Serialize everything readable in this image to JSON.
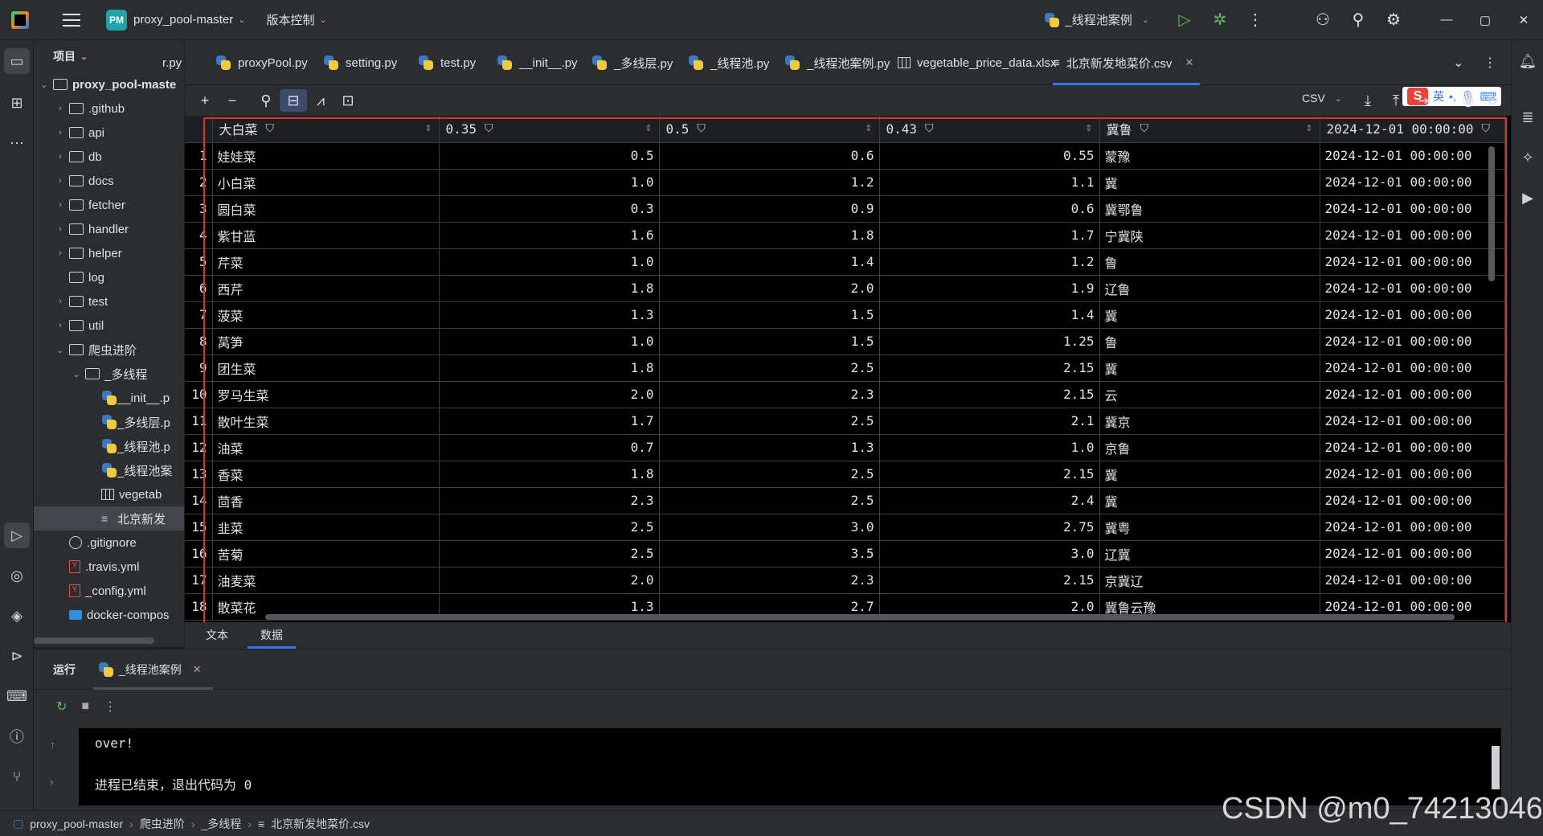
{
  "titlebar": {
    "project_badge": "PM",
    "project_name": "proxy_pool-master",
    "vcs": "版本控制",
    "run_config": "_线程池案例"
  },
  "project_panel": {
    "title": "项目",
    "root": "proxy_pool-maste",
    "items": [
      {
        "label": ".github",
        "type": "folder",
        "indent": 1,
        "arrow": "›"
      },
      {
        "label": "api",
        "type": "folder",
        "indent": 1,
        "arrow": "›"
      },
      {
        "label": "db",
        "type": "folder",
        "indent": 1,
        "arrow": "›"
      },
      {
        "label": "docs",
        "type": "folder",
        "indent": 1,
        "arrow": "›"
      },
      {
        "label": "fetcher",
        "type": "folder",
        "indent": 1,
        "arrow": "›"
      },
      {
        "label": "handler",
        "type": "folder",
        "indent": 1,
        "arrow": "›"
      },
      {
        "label": "helper",
        "type": "folder",
        "indent": 1,
        "arrow": "›"
      },
      {
        "label": "log",
        "type": "folder",
        "indent": 1,
        "arrow": ""
      },
      {
        "label": "test",
        "type": "folder",
        "indent": 1,
        "arrow": "›"
      },
      {
        "label": "util",
        "type": "folder",
        "indent": 1,
        "arrow": "›"
      },
      {
        "label": "爬虫进阶",
        "type": "folder",
        "indent": 1,
        "arrow": "⌄"
      },
      {
        "label": "_多线程",
        "type": "folder",
        "indent": 2,
        "arrow": "⌄"
      },
      {
        "label": "__init__.p",
        "type": "python",
        "indent": 3,
        "arrow": ""
      },
      {
        "label": "_多线层.p",
        "type": "python",
        "indent": 3,
        "arrow": ""
      },
      {
        "label": "_线程池.p",
        "type": "python",
        "indent": 3,
        "arrow": ""
      },
      {
        "label": "_线程池案",
        "type": "python",
        "indent": 3,
        "arrow": ""
      },
      {
        "label": "vegetab",
        "type": "table",
        "indent": 3,
        "arrow": ""
      },
      {
        "label": "北京新发",
        "type": "text",
        "indent": 3,
        "arrow": "",
        "selected": true
      },
      {
        "label": ".gitignore",
        "type": "git",
        "indent": 1,
        "arrow": ""
      },
      {
        "label": ".travis.yml",
        "type": "yaml",
        "indent": 1,
        "arrow": ""
      },
      {
        "label": "_config.yml",
        "type": "yaml",
        "indent": 1,
        "arrow": ""
      },
      {
        "label": "docker-compos",
        "type": "docker",
        "indent": 1,
        "arrow": ""
      }
    ]
  },
  "editor_tabs": [
    {
      "label": "r.py",
      "icon": "none"
    },
    {
      "label": "proxyPool.py",
      "icon": "python"
    },
    {
      "label": "setting.py",
      "icon": "python"
    },
    {
      "label": "test.py",
      "icon": "python"
    },
    {
      "label": "__init__.py",
      "icon": "python"
    },
    {
      "label": "_多线层.py",
      "icon": "python"
    },
    {
      "label": "_线程池.py",
      "icon": "python"
    },
    {
      "label": "_线程池案例.py",
      "icon": "python"
    },
    {
      "label": "vegetable_price_data.xlsx",
      "icon": "table"
    },
    {
      "label": "北京新发地菜价.csv",
      "icon": "text",
      "active": true
    }
  ],
  "data_toolbar": {
    "format": "CSV",
    "ime_label": "英"
  },
  "grid": {
    "headers": [
      "大白菜",
      "0.35",
      "0.5",
      "0.43",
      "冀鲁",
      "2024-12-01 00:00:00"
    ],
    "rows": [
      [
        "1",
        "娃娃菜",
        "0.5",
        "0.6",
        "0.55",
        "蒙豫",
        "2024-12-01 00:00:00"
      ],
      [
        "2",
        "小白菜",
        "1.0",
        "1.2",
        "1.1",
        "冀",
        "2024-12-01 00:00:00"
      ],
      [
        "3",
        "圆白菜",
        "0.3",
        "0.9",
        "0.6",
        "冀鄂鲁",
        "2024-12-01 00:00:00"
      ],
      [
        "4",
        "紫甘蓝",
        "1.6",
        "1.8",
        "1.7",
        "宁冀陕",
        "2024-12-01 00:00:00"
      ],
      [
        "5",
        "芹菜",
        "1.0",
        "1.4",
        "1.2",
        "鲁",
        "2024-12-01 00:00:00"
      ],
      [
        "6",
        "西芹",
        "1.8",
        "2.0",
        "1.9",
        "辽鲁",
        "2024-12-01 00:00:00"
      ],
      [
        "7",
        "菠菜",
        "1.3",
        "1.5",
        "1.4",
        "冀",
        "2024-12-01 00:00:00"
      ],
      [
        "8",
        "莴笋",
        "1.0",
        "1.5",
        "1.25",
        "鲁",
        "2024-12-01 00:00:00"
      ],
      [
        "9",
        "团生菜",
        "1.8",
        "2.5",
        "2.15",
        "冀",
        "2024-12-01 00:00:00"
      ],
      [
        "10",
        "罗马生菜",
        "2.0",
        "2.3",
        "2.15",
        "云",
        "2024-12-01 00:00:00"
      ],
      [
        "11",
        "散叶生菜",
        "1.7",
        "2.5",
        "2.1",
        "冀京",
        "2024-12-01 00:00:00"
      ],
      [
        "12",
        "油菜",
        "0.7",
        "1.3",
        "1.0",
        "京鲁",
        "2024-12-01 00:00:00"
      ],
      [
        "13",
        "香菜",
        "1.8",
        "2.5",
        "2.15",
        "冀",
        "2024-12-01 00:00:00"
      ],
      [
        "14",
        "茴香",
        "2.3",
        "2.5",
        "2.4",
        "冀",
        "2024-12-01 00:00:00"
      ],
      [
        "15",
        "韭菜",
        "2.5",
        "3.0",
        "2.75",
        "冀粤",
        "2024-12-01 00:00:00"
      ],
      [
        "16",
        "苦菊",
        "2.5",
        "3.5",
        "3.0",
        "辽冀",
        "2024-12-01 00:00:00"
      ],
      [
        "17",
        "油麦菜",
        "2.0",
        "2.3",
        "2.15",
        "京冀辽",
        "2024-12-01 00:00:00"
      ],
      [
        "18",
        "散菜花",
        "1.3",
        "2.7",
        "2.0",
        "冀鲁云豫",
        "2024-12-01 00:00:00"
      ]
    ]
  },
  "view_tabs": [
    "文本",
    "数据"
  ],
  "run_panel": {
    "title": "运行",
    "tab_label": "_线程池案例",
    "console_lines": [
      "over!",
      "",
      "进程已结束，退出代码为 0"
    ]
  },
  "status_bar": {
    "breadcrumbs": [
      "proxy_pool-master",
      "爬虫进阶",
      "_多线程",
      "北京新发地菜价.csv"
    ]
  },
  "watermark": "CSDN @m0_74213046"
}
